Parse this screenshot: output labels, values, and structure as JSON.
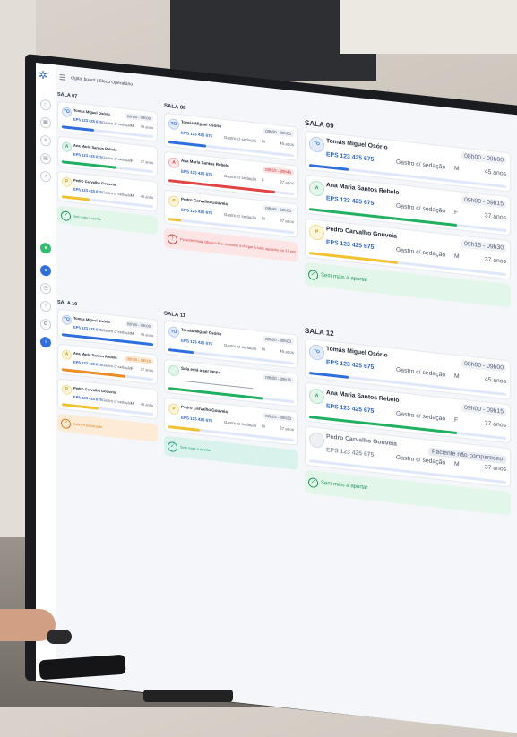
{
  "app": {
    "title": "digital board | Bloco Operatório"
  },
  "colors": {
    "blue": "#2e6fe0",
    "green": "#1fb15f",
    "yellow": "#f2c12e",
    "red": "#e24444",
    "orange": "#f08a24"
  },
  "sidebar": {
    "icons": [
      "logo-icon",
      "home-icon",
      "calendar-icon",
      "list-icon",
      "chart-icon",
      "check-icon",
      "user-icon",
      "clock-icon",
      "alert-icon",
      "settings-icon",
      "info-icon",
      "avatar-icon"
    ]
  },
  "rooms": [
    {
      "title": "SALA 07",
      "patients": [
        {
          "initials": "TO",
          "name": "Tomás Miguel Osório",
          "eps": "EPS 123 425 675",
          "procedure": "Gastro c/ sedação",
          "sex": "M",
          "age": "45 anos",
          "time": "08h00 - 09h00",
          "progress": 0.35,
          "color": "blue"
        },
        {
          "initials": "A",
          "name": "Ana Maria Santos Rebelo",
          "eps": "EPS 123 425 675",
          "procedure": "Gastro c/ sedação",
          "sex": "F",
          "age": "37 anos",
          "time": "",
          "progress": 0.6,
          "color": "green"
        },
        {
          "initials": "P",
          "name": "Pedro Carvalho Gouveia",
          "eps": "EPS 123 425 675",
          "procedure": "Gastro c/ sedação",
          "sex": "M",
          "age": "45 anos",
          "time": "",
          "progress": 0.3,
          "color": "yellow"
        }
      ],
      "note": {
        "text": "Sem mais a aportar",
        "kind": "green"
      }
    },
    {
      "title": "SALA 08",
      "patients": [
        {
          "initials": "TO",
          "name": "Tomás Miguel Osório",
          "eps": "EPS 123 425 675",
          "procedure": "Gastro c/ sedação",
          "sex": "M",
          "age": "45 anos",
          "time": "08h00 - 09h00",
          "progress": 0.3,
          "color": "blue"
        },
        {
          "initials": "A",
          "name": "Ana Maria Santos Rebelo",
          "eps": "EPS 123 425 675",
          "procedure": "Gastro c/ sedação",
          "sex": "F",
          "age": "37 anos",
          "time": "09h15 - 09h45",
          "progress": 0.85,
          "color": "red"
        },
        {
          "initials": "P",
          "name": "Pedro Carvalho Gouveia",
          "eps": "EPS 123 425 675",
          "procedure": "Gastro c/ sedação",
          "sex": "M",
          "age": "37 anos",
          "time": "09h45 - 10h00",
          "progress": 0.1,
          "color": "yellow"
        }
      ],
      "note": {
        "text": "Paciente Maria Oliveira Pio: atrasado a chegar à sala: aguarda por 15 min",
        "kind": "red"
      }
    },
    {
      "title": "SALA 09",
      "patients": [
        {
          "initials": "TO",
          "name": "Tomás Miguel Osório",
          "eps": "EPS 123 425 675",
          "procedure": "Gastro c/ sedação",
          "sex": "M",
          "age": "45 anos",
          "time": "08h00 - 09h00",
          "progress": 0.2,
          "color": "blue"
        },
        {
          "initials": "A",
          "name": "Ana Maria Santos Rebelo",
          "eps": "EPS 123 425 675",
          "procedure": "Gastro c/ sedação",
          "sex": "F",
          "age": "37 anos",
          "time": "09h00 - 09h15",
          "progress": 0.75,
          "color": "green"
        },
        {
          "initials": "P",
          "name": "Pedro Carvalho Gouveia",
          "eps": "EPS 123 425 675",
          "procedure": "Gastro c/ sedação",
          "sex": "M",
          "age": "37 anos",
          "time": "09h15 - 09h30",
          "progress": 0.45,
          "color": "yellow"
        }
      ],
      "note": {
        "text": "Sem mais a aportar",
        "kind": "green"
      }
    },
    {
      "title": "SALA 10",
      "patients": [
        {
          "initials": "TO",
          "name": "Tomás Miguel Osório",
          "eps": "EPS 123 425 675",
          "procedure": "Gastro c/ sedação",
          "sex": "M",
          "age": "45 anos",
          "time": "08h00 - 09h00",
          "progress": 1.0,
          "color": "blue"
        },
        {
          "initials": "A",
          "name": "Ana Maria Santos Rebelo",
          "eps": "EPS 123 425 675",
          "procedure": "Gastro c/ sedação",
          "sex": "F",
          "age": "37 anos",
          "time": "09h00 - 09h15",
          "progress": 0.7,
          "color": "orange"
        },
        {
          "initials": "P",
          "name": "Pedro Carvalho Gouveia",
          "eps": "EPS 123 425 675",
          "procedure": "Gastro c/ sedação",
          "sex": "M",
          "age": "45 anos",
          "time": "",
          "progress": 0.4,
          "color": "yellow"
        }
      ],
      "note": {
        "text": "Sala em preparação",
        "kind": "orange"
      }
    },
    {
      "title": "SALA 11",
      "patients": [
        {
          "initials": "TO",
          "name": "Tomás Miguel Osório",
          "eps": "EPS 123 425 675",
          "procedure": "Gastro c/ sedação",
          "sex": "M",
          "age": "45 anos",
          "time": "08h00 - 09h00",
          "progress": 0.2,
          "color": "blue"
        },
        {
          "initials": "",
          "name": "Sala está a ser limpa",
          "eps": "",
          "procedure": "",
          "sex": "",
          "age": "",
          "time": "09h00 - 09h15",
          "progress": 0.75,
          "color": "green"
        },
        {
          "initials": "P",
          "name": "Pedro Carvalho Gouveia",
          "eps": "EPS 123 425 675",
          "procedure": "Gastro c/ sedação",
          "sex": "M",
          "age": "37 anos",
          "time": "09h15 - 09h30",
          "progress": 0.25,
          "color": "yellow"
        }
      ],
      "note": {
        "text": "Sem mais a aportar",
        "kind": "teal"
      }
    },
    {
      "title": "SALA 12",
      "patients": [
        {
          "initials": "TO",
          "name": "Tomás Miguel Osório",
          "eps": "EPS 123 425 675",
          "procedure": "Gastro c/ sedação",
          "sex": "M",
          "age": "45 anos",
          "time": "08h00 - 09h00",
          "progress": 0.2,
          "color": "blue"
        },
        {
          "initials": "A",
          "name": "Ana Maria Santos Rebelo",
          "eps": "EPS 123 425 675",
          "procedure": "Gastro c/ sedação",
          "sex": "F",
          "age": "37 anos",
          "time": "09h00 - 09h15",
          "progress": 0.75,
          "color": "green"
        },
        {
          "initials": "",
          "name": "Pedro Carvalho Gouveia",
          "eps": "EPS 123 425 675",
          "procedure": "Gastro c/ sedação",
          "sex": "M",
          "age": "37 anos",
          "time": "",
          "pending": "Paciente não compareceu",
          "progress": 0,
          "color": "grey"
        }
      ],
      "note": {
        "text": "Sem mais a aportar",
        "kind": "green"
      }
    }
  ]
}
